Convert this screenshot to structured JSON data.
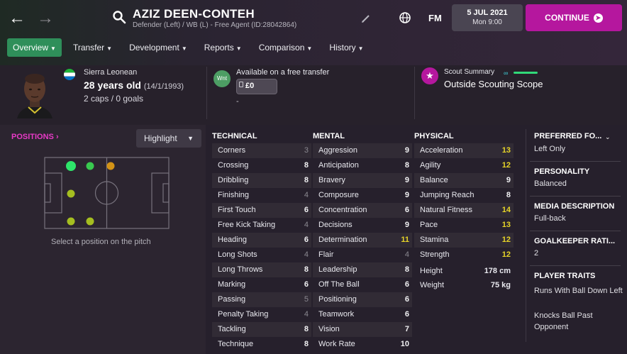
{
  "header": {
    "player_name": "AZIZ DEEN-CONTEH",
    "player_subtitle": "Defender (Left) / WB (L) - Free Agent (ID:28042864)",
    "fm_logo": "FM",
    "date": "5 JUL 2021",
    "day_time": "Mon 9:00",
    "continue_label": "CONTINUE",
    "icons": [
      "back-arrow-icon",
      "forward-arrow-icon",
      "search-icon",
      "pencil-icon",
      "globe-icon",
      "continue-arrow-icon"
    ]
  },
  "tabs": [
    {
      "label": "Overview",
      "active": true
    },
    {
      "label": "Transfer"
    },
    {
      "label": "Development"
    },
    {
      "label": "Reports"
    },
    {
      "label": "Comparison"
    },
    {
      "label": "History"
    }
  ],
  "info": {
    "nationality": "Sierra Leonean",
    "age": "28 years old",
    "dob": "(14/1/1993)",
    "caps": "2 caps / 0 goals",
    "transfer_badge": "Wnt",
    "transfer_status": "Available on a free transfer",
    "fee": "£0",
    "fee_note": "-",
    "scout_title": "Scout Summary",
    "scout_value": "Outside Scouting Scope"
  },
  "positions": {
    "title": "POSITIONS",
    "highlight_label": "Highlight",
    "hint": "Select a position on the pitch"
  },
  "technical": {
    "title": "TECHNICAL",
    "rows": [
      {
        "name": "Corners",
        "value": "3"
      },
      {
        "name": "Crossing",
        "value": "8"
      },
      {
        "name": "Dribbling",
        "value": "8"
      },
      {
        "name": "Finishing",
        "value": "4"
      },
      {
        "name": "First Touch",
        "value": "6"
      },
      {
        "name": "Free Kick Taking",
        "value": "4"
      },
      {
        "name": "Heading",
        "value": "6"
      },
      {
        "name": "Long Shots",
        "value": "4"
      },
      {
        "name": "Long Throws",
        "value": "8"
      },
      {
        "name": "Marking",
        "value": "6"
      },
      {
        "name": "Passing",
        "value": "5"
      },
      {
        "name": "Penalty Taking",
        "value": "4"
      },
      {
        "name": "Tackling",
        "value": "8"
      },
      {
        "name": "Technique",
        "value": "8"
      }
    ]
  },
  "mental": {
    "title": "MENTAL",
    "rows": [
      {
        "name": "Aggression",
        "value": "9"
      },
      {
        "name": "Anticipation",
        "value": "8"
      },
      {
        "name": "Bravery",
        "value": "9"
      },
      {
        "name": "Composure",
        "value": "9"
      },
      {
        "name": "Concentration",
        "value": "6"
      },
      {
        "name": "Decisions",
        "value": "9"
      },
      {
        "name": "Determination",
        "value": "11"
      },
      {
        "name": "Flair",
        "value": "4"
      },
      {
        "name": "Leadership",
        "value": "8"
      },
      {
        "name": "Off The Ball",
        "value": "6"
      },
      {
        "name": "Positioning",
        "value": "6"
      },
      {
        "name": "Teamwork",
        "value": "6"
      },
      {
        "name": "Vision",
        "value": "7"
      },
      {
        "name": "Work Rate",
        "value": "10"
      }
    ]
  },
  "physical": {
    "title": "PHYSICAL",
    "rows": [
      {
        "name": "Acceleration",
        "value": "13"
      },
      {
        "name": "Agility",
        "value": "12"
      },
      {
        "name": "Balance",
        "value": "9"
      },
      {
        "name": "Jumping Reach",
        "value": "8"
      },
      {
        "name": "Natural Fitness",
        "value": "14"
      },
      {
        "name": "Pace",
        "value": "13"
      },
      {
        "name": "Stamina",
        "value": "12"
      },
      {
        "name": "Strength",
        "value": "12"
      }
    ],
    "height_label": "Height",
    "height_value": "178 cm",
    "weight_label": "Weight",
    "weight_value": "75 kg"
  },
  "side": {
    "preferred_foot_title": "PREFERRED FO...",
    "preferred_foot_value": "Left Only",
    "personality_title": "PERSONALITY",
    "personality_value": "Balanced",
    "media_title": "MEDIA DESCRIPTION",
    "media_value": "Full-back",
    "gk_title": "GOALKEEPER RATI...",
    "gk_value": "2",
    "traits_title": "PLAYER TRAITS",
    "traits": [
      "Runs With Ball Down Left",
      "Knocks Ball Past Opponent"
    ]
  },
  "colors": {
    "accent_pink": "#b5179e",
    "active_tab_green": "#2f8f5a",
    "high_value_yellow": "#e6d428"
  }
}
